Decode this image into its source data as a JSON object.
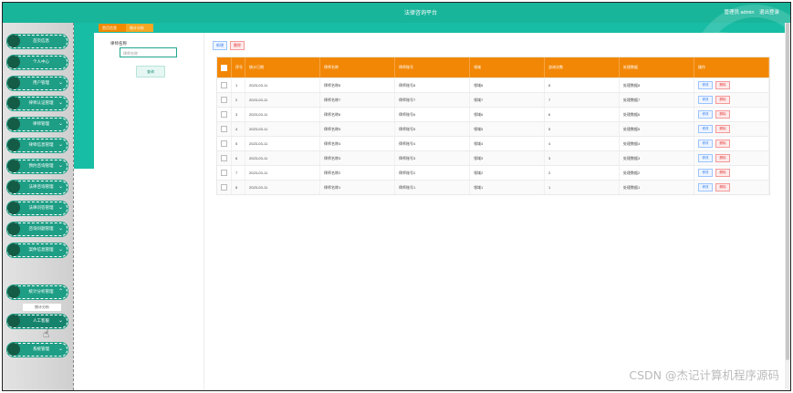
{
  "header": {
    "title": "法律咨询平台",
    "user_text": "管理员 admin",
    "logout": "退出登录"
  },
  "tabs": {
    "home": "首页信息",
    "current": "统计分析"
  },
  "sidebar": {
    "items": [
      {
        "label": "首页信息"
      },
      {
        "label": "个人中心"
      },
      {
        "label": "用户管理"
      },
      {
        "label": "律师认证管理"
      },
      {
        "label": "律师管理"
      },
      {
        "label": "律师信息管理"
      },
      {
        "label": "预约咨询管理"
      },
      {
        "label": "法律咨询管理"
      },
      {
        "label": "法律问答管理"
      },
      {
        "label": "咨询问题管理"
      },
      {
        "label": "案件信息管理"
      },
      {
        "label": "统计分析管理"
      },
      {
        "label": "人工客服"
      },
      {
        "label": "系统管理"
      }
    ],
    "submenu_label": "统计分析"
  },
  "search": {
    "label": "律师名称",
    "placeholder": "律师名称",
    "button": "查询"
  },
  "actions": {
    "add": "新增",
    "delete": "删除"
  },
  "table": {
    "headers": [
      "",
      "序号",
      "统计日期",
      "律师名称",
      "律师账号",
      "领域",
      "咨询次数",
      "处理数据",
      "操作"
    ],
    "row_actions": {
      "edit": "修改",
      "delete": "删除"
    },
    "rows": [
      {
        "index": "1",
        "date": "2023-03-11",
        "name": "律师名称8",
        "account": "律师账号8",
        "field": "领域8",
        "count": "8",
        "data": "处理数据8"
      },
      {
        "index": "2",
        "date": "2023-03-11",
        "name": "律师名称7",
        "account": "律师账号7",
        "field": "领域7",
        "count": "7",
        "data": "处理数据7"
      },
      {
        "index": "3",
        "date": "2023-03-11",
        "name": "律师名称6",
        "account": "律师账号6",
        "field": "领域6",
        "count": "6",
        "data": "处理数据6"
      },
      {
        "index": "4",
        "date": "2023-03-11",
        "name": "律师名称5",
        "account": "律师账号5",
        "field": "领域5",
        "count": "5",
        "data": "处理数据5"
      },
      {
        "index": "5",
        "date": "2023-03-11",
        "name": "律师名称4",
        "account": "律师账号4",
        "field": "领域4",
        "count": "4",
        "data": "处理数据4"
      },
      {
        "index": "6",
        "date": "2023-03-11",
        "name": "律师名称3",
        "account": "律师账号3",
        "field": "领域3",
        "count": "3",
        "data": "处理数据3"
      },
      {
        "index": "7",
        "date": "2023-03-11",
        "name": "律师名称2",
        "account": "律师账号2",
        "field": "领域2",
        "count": "2",
        "data": "处理数据2"
      },
      {
        "index": "8",
        "date": "2023-03-11",
        "name": "律师名称1",
        "account": "律师账号1",
        "field": "领域1",
        "count": "1",
        "data": "处理数据1"
      }
    ]
  },
  "watermark": "CSDN @杰记计算机程序源码",
  "colors": {
    "primary": "#19b59b",
    "accent": "#f28705"
  }
}
